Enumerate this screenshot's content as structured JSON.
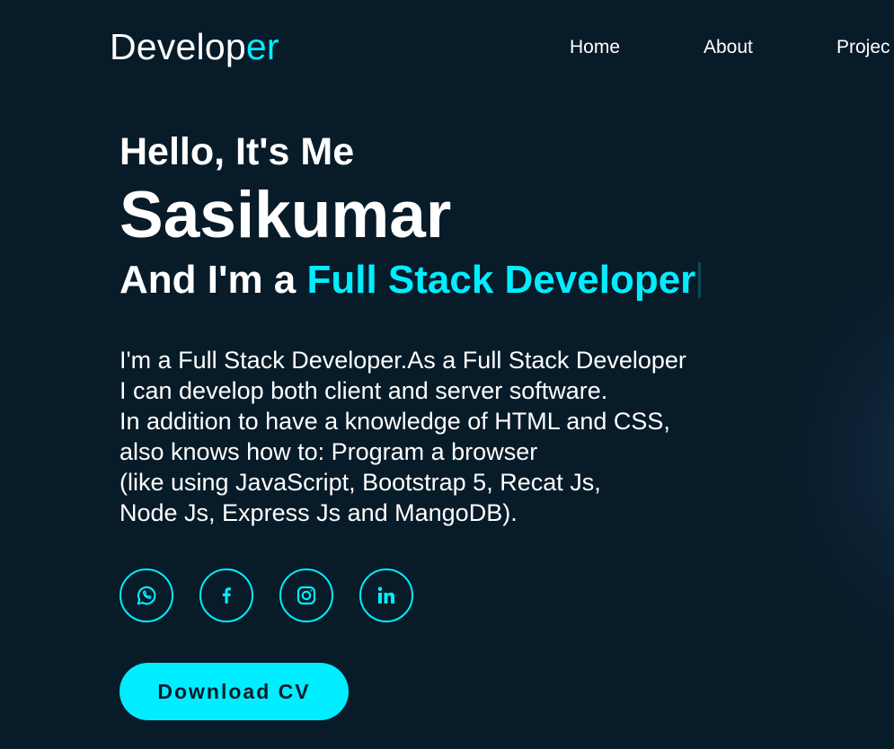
{
  "header": {
    "logo_main": "Develop",
    "logo_accent": "er",
    "nav": [
      {
        "label": "Home"
      },
      {
        "label": "About"
      },
      {
        "label": "Projec"
      }
    ]
  },
  "hero": {
    "greeting": "Hello, It's Me",
    "name": "Sasikumar",
    "role_prefix": "And I'm a ",
    "role_typed": "Full Stack Developer",
    "bio_lines": [
      "I'm a Full Stack Developer.As a Full Stack Developer",
      "I can develop both client and server software.",
      "In addition to have a knowledge of HTML and CSS,",
      "also knows how to: Program a browser",
      "(like using JavaScript, Bootstrap 5, Recat Js,",
      "Node Js, Express Js and MangoDB)."
    ],
    "socials": [
      {
        "icon": "whatsapp-icon"
      },
      {
        "icon": "facebook-icon"
      },
      {
        "icon": "instagram-icon"
      },
      {
        "icon": "linkedin-icon"
      }
    ],
    "cta_label": "Download CV"
  },
  "colors": {
    "background": "#081b29",
    "accent": "#00eeff",
    "text": "#ffffff"
  }
}
